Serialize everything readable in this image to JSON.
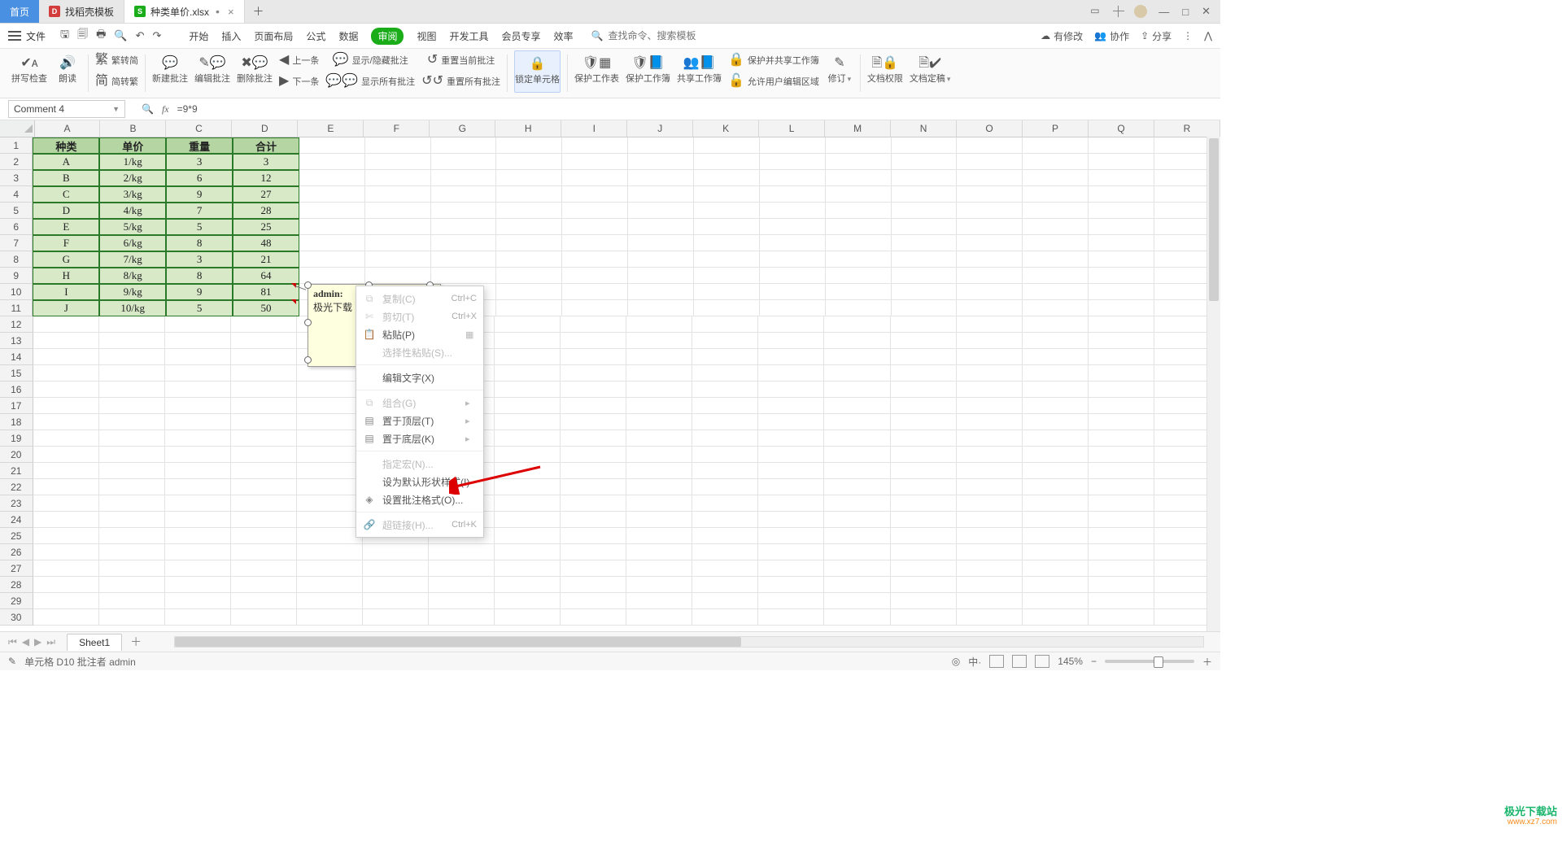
{
  "title_tabs": {
    "home": "首页",
    "doc1": "找稻壳模板",
    "doc2": "种类单价.xlsx"
  },
  "menu": {
    "file": "文件",
    "tabs": [
      "开始",
      "插入",
      "页面布局",
      "公式",
      "数据",
      "审阅",
      "视图",
      "开发工具",
      "会员专享",
      "效率"
    ],
    "active_index": 5,
    "search_placeholder": "查找命令、搜索模板",
    "search_icon_text": "Q",
    "right": {
      "changes": "有修改",
      "collab": "协作",
      "share": "分享"
    }
  },
  "ribbon": {
    "spellcheck": "拼写检查",
    "read": "朗读",
    "t2s_1": "繁转简",
    "t2s_2": "简转繁",
    "new_comment": "新建批注",
    "edit_comment": "编辑批注",
    "del_comment": "删除批注",
    "prev": "上一条",
    "next": "下一条",
    "show_hide": "显示/隐藏批注",
    "show_all": "显示所有批注",
    "reset_cur": "重置当前批注",
    "reset_all": "重置所有批注",
    "lock_cells": "锁定单元格",
    "protect_sheet": "保护工作表",
    "protect_book": "保护工作簿",
    "share_book": "共享工作簿",
    "protect_share": "保护并共享工作簿",
    "allow_edit": "允许用户编辑区域",
    "track": "修订",
    "doc_perm": "文档权限",
    "doc_lock": "文档定稿"
  },
  "formula": {
    "name_box": "Comment 4",
    "fx": "=9*9"
  },
  "grid": {
    "cols": [
      "A",
      "B",
      "C",
      "D",
      "E",
      "F",
      "G",
      "H",
      "I",
      "J",
      "K",
      "L",
      "M",
      "N",
      "O",
      "P",
      "Q",
      "R"
    ],
    "row_count": 30,
    "headers": [
      "种类",
      "单价",
      "重量",
      "合计"
    ],
    "data": [
      [
        "A",
        "1/kg",
        "3",
        "3"
      ],
      [
        "B",
        "2/kg",
        "6",
        "12"
      ],
      [
        "C",
        "3/kg",
        "9",
        "27"
      ],
      [
        "D",
        "4/kg",
        "7",
        "28"
      ],
      [
        "E",
        "5/kg",
        "5",
        "25"
      ],
      [
        "F",
        "6/kg",
        "8",
        "48"
      ],
      [
        "G",
        "7/kg",
        "3",
        "21"
      ],
      [
        "H",
        "8/kg",
        "8",
        "64"
      ],
      [
        "I",
        "9/kg",
        "9",
        "81"
      ],
      [
        "J",
        "10/kg",
        "5",
        "50"
      ]
    ]
  },
  "comment": {
    "author": "admin:",
    "body": "极光下载"
  },
  "context_menu": {
    "items": [
      {
        "ico": "⧉",
        "label": "复制(C)",
        "sc": "Ctrl+C",
        "en": false
      },
      {
        "ico": "✄",
        "label": "剪切(T)",
        "sc": "Ctrl+X",
        "en": false
      },
      {
        "ico": "📋",
        "label": "粘贴(P)",
        "sc": "",
        "en": true,
        "rico": "▦"
      },
      {
        "ico": "",
        "label": "选择性粘贴(S)...",
        "sc": "",
        "en": false
      },
      {
        "sep": true
      },
      {
        "ico": "",
        "label": "编辑文字(X)",
        "sc": "",
        "en": true
      },
      {
        "sep": true
      },
      {
        "ico": "⧉",
        "label": "组合(G)",
        "sc": "",
        "en": false,
        "rico": "▸"
      },
      {
        "ico": "▤",
        "label": "置于顶层(T)",
        "sc": "",
        "en": true,
        "rico": "▸"
      },
      {
        "ico": "▤",
        "label": "置于底层(K)",
        "sc": "",
        "en": true,
        "rico": "▸"
      },
      {
        "sep": true
      },
      {
        "ico": "",
        "label": "指定宏(N)...",
        "sc": "",
        "en": false
      },
      {
        "ico": "",
        "label": "设为默认形状样式(I)",
        "sc": "",
        "en": true
      },
      {
        "ico": "◈",
        "label": "设置批注格式(O)...",
        "sc": "",
        "en": true
      },
      {
        "sep": true
      },
      {
        "ico": "🔗",
        "label": "超链接(H)...",
        "sc": "Ctrl+K",
        "en": false
      }
    ]
  },
  "sheets": {
    "name": "Sheet1"
  },
  "status": {
    "left_icon": "✎",
    "text": "单元格 D10 批注者 admin",
    "zoom": "145%",
    "eye": "◎",
    "ch": "中·"
  },
  "watermark": {
    "l1": "极光下载站",
    "l2": "www.xz7.com"
  }
}
